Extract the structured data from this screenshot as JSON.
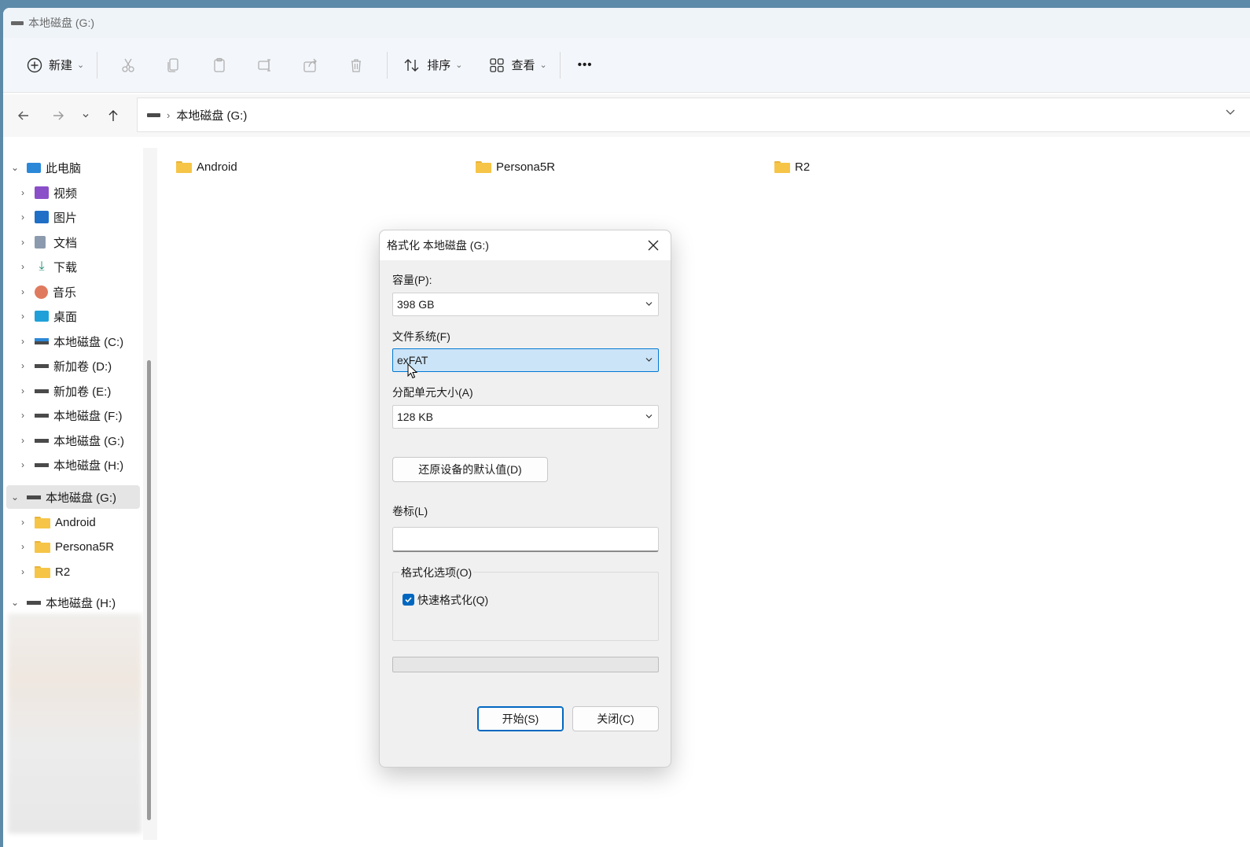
{
  "window": {
    "title": "本地磁盘 (G:)"
  },
  "toolbar": {
    "new_label": "新建",
    "sort_label": "排序",
    "view_label": "查看",
    "more_label": "•••"
  },
  "address": {
    "path": "本地磁盘 (G:)"
  },
  "sidebar": {
    "this_pc": "此电脑",
    "items": [
      "视频",
      "图片",
      "文档",
      "下载",
      "音乐",
      "桌面",
      "本地磁盘 (C:)",
      "新加卷 (D:)",
      "新加卷 (E:)",
      "本地磁盘 (F:)",
      "本地磁盘 (G:)",
      "本地磁盘 (H:)"
    ],
    "current_drive": "本地磁盘 (G:)",
    "current_children": [
      "Android",
      "Persona5R",
      "R2"
    ],
    "other_drive": "本地磁盘 (H:)"
  },
  "content": {
    "folders": [
      "Android",
      "Persona5R",
      "R2"
    ]
  },
  "dialog": {
    "title": "格式化 本地磁盘 (G:)",
    "capacity_label": "容量(P):",
    "capacity_value": "398 GB",
    "filesystem_label": "文件系统(F)",
    "filesystem_value": "exFAT",
    "alloc_label": "分配单元大小(A)",
    "alloc_value": "128 KB",
    "restore_button": "还原设备的默认值(D)",
    "volume_label": "卷标(L)",
    "volume_value": "",
    "options_title": "格式化选项(O)",
    "quick_format_label": "快速格式化(Q)",
    "quick_format_checked": true,
    "progress_fraction": 0,
    "start_button": "开始(S)",
    "close_button": "关闭(C)"
  }
}
